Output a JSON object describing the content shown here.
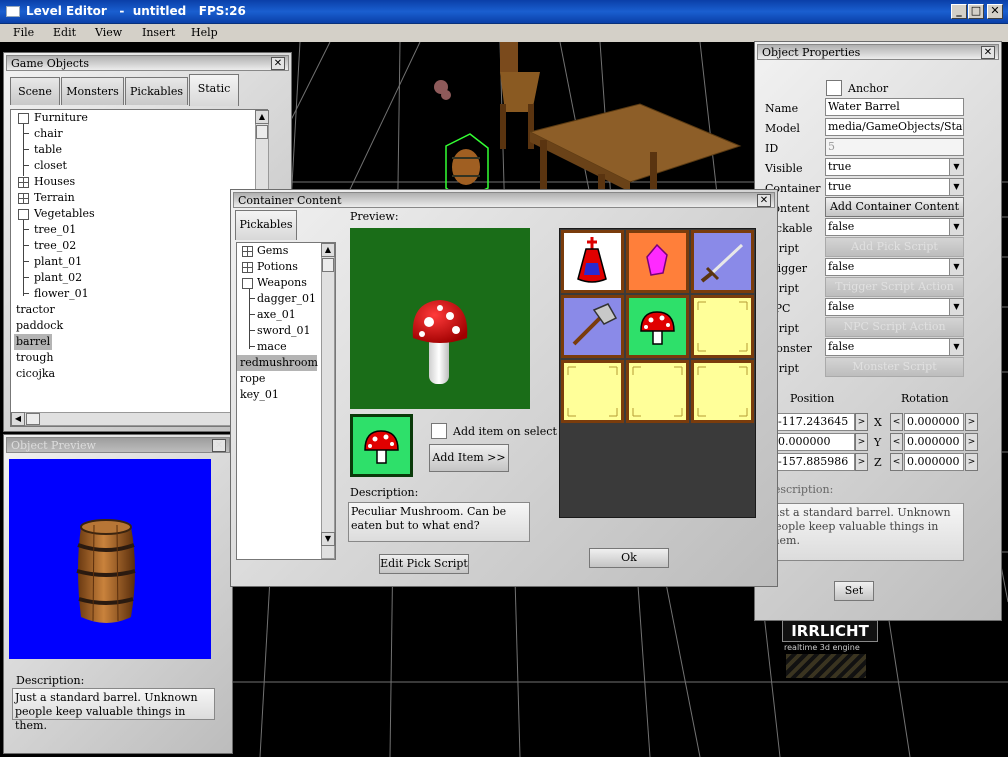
{
  "window": {
    "title": "Level Editor   -  untitled   FPS:26",
    "min": "_",
    "max": "□",
    "close": "✕"
  },
  "menu": [
    "File",
    "Edit",
    "View",
    "Insert",
    "Help"
  ],
  "game_objects": {
    "title": "Game Objects",
    "close": "✕",
    "tabs": [
      "Scene",
      "Monsters",
      "Pickables",
      "Static"
    ],
    "active_tab": "Static",
    "tree": [
      {
        "label": "Furniture",
        "box": "minus"
      },
      {
        "label": "chair"
      },
      {
        "label": "table"
      },
      {
        "label": "closet"
      },
      {
        "label": "Houses",
        "box": "plus"
      },
      {
        "label": "Terrain",
        "box": "plus"
      },
      {
        "label": "Vegetables",
        "box": "minus"
      },
      {
        "label": "tree_01"
      },
      {
        "label": "tree_02"
      },
      {
        "label": "plant_01"
      },
      {
        "label": "plant_02"
      },
      {
        "label": "flower_01"
      },
      {
        "label": "tractor"
      },
      {
        "label": "paddock"
      },
      {
        "label": "barrel"
      },
      {
        "label": "trough"
      },
      {
        "label": "cicojka"
      }
    ],
    "selected": "barrel"
  },
  "object_preview": {
    "title": "Object Preview",
    "close": "✕",
    "description_label": "Description:",
    "description": "Just a standard barrel. Unknown people keep valuable things in them."
  },
  "container_content": {
    "title": "Container Content",
    "close": "✕",
    "tab": "Pickables",
    "tree": [
      {
        "label": "Gems",
        "box": "plus"
      },
      {
        "label": "Potions",
        "box": "plus"
      },
      {
        "label": "Weapons",
        "box": "minus"
      },
      {
        "label": "dagger_01"
      },
      {
        "label": "axe_01"
      },
      {
        "label": "sword_01"
      },
      {
        "label": "mace"
      },
      {
        "label": "redmushroom"
      },
      {
        "label": "rope"
      },
      {
        "label": "key_01"
      }
    ],
    "selected": "redmushroom",
    "preview_label": "Preview:",
    "add_on_select": "Add item on select",
    "add_item": "Add Item >>",
    "description_label": "Description:",
    "description": "Peculiar Mushroom. Can be eaten but to what end?",
    "edit_pick_script": "Edit Pick Script",
    "ok": "Ok",
    "slots": [
      {
        "item": "potion-icon",
        "bg": "#ffffff"
      },
      {
        "item": "gem-icon",
        "bg": "#ff7f3a"
      },
      {
        "item": "sword-icon",
        "bg": "#8a8ae8"
      },
      {
        "item": "axe-icon",
        "bg": "#8a8ae8"
      },
      {
        "item": "mushroom-icon",
        "bg": "#2ee06a"
      },
      {
        "item": "empty",
        "bg": "#ffff99"
      },
      {
        "item": "empty",
        "bg": "#ffff99"
      },
      {
        "item": "empty",
        "bg": "#ffff99"
      },
      {
        "item": "empty",
        "bg": "#ffff99"
      }
    ]
  },
  "object_properties": {
    "title": "Object Properties",
    "close": "✕",
    "anchor": "Anchor",
    "rows": {
      "name": {
        "label": "Name",
        "value": "Water Barrel"
      },
      "model": {
        "label": "Model",
        "value": "media/GameObjects/Static"
      },
      "id": {
        "label": "ID",
        "value": "5"
      },
      "visible": {
        "label": "Visible",
        "value": "true"
      },
      "container": {
        "label": "Container",
        "value": "true"
      },
      "content": {
        "label": "Content",
        "button": "Add Container Content"
      },
      "pickable": {
        "label": "Pickable",
        "value": "false"
      },
      "pick_script": {
        "label": "Script",
        "button": "Add Pick Script"
      },
      "trigger": {
        "label": "Trigger",
        "value": "false"
      },
      "trigger_script": {
        "label": "Script",
        "button": "Trigger Script Action"
      },
      "npc": {
        "label": "NPC",
        "value": "false"
      },
      "npc_script": {
        "label": "Script",
        "button": "NPC Script Action"
      },
      "monster": {
        "label": "Monster",
        "value": "false"
      },
      "monster_script": {
        "label": "Script",
        "button": "Monster Script"
      }
    },
    "position_label": "Position",
    "rotation_label": "Rotation",
    "position": [
      "-117.243645",
      "0.000000",
      "-157.885986"
    ],
    "rotation": [
      "0.000000",
      "0.000000",
      "0.000000"
    ],
    "axes": [
      "X",
      "Y",
      "Z"
    ],
    "description_label": "Description:",
    "description": "Just a standard barrel. Unknown people keep valuable things in them.",
    "set": "Set"
  },
  "logo": {
    "text": "IRRLICHT",
    "sub": "realtime 3d engine"
  }
}
